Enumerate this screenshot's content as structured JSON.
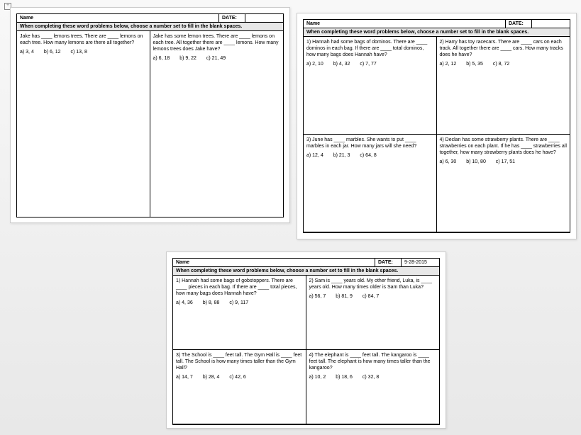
{
  "labels": {
    "name": "Name",
    "date": "DATE:",
    "instruction": "When completing these word problems below, choose a number set to fill in the blank spaces.",
    "handle": "+"
  },
  "pages": [
    {
      "date_value": "",
      "layout": "grid2",
      "cells": [
        {
          "text": "Jake has ____ lemons trees. There are ____ lemons on each tree. How many lemons are there all together?",
          "opts": [
            "a) 3, 4",
            "b) 6, 12",
            "c) 13, 8"
          ]
        },
        {
          "text": "Jake has some lemon trees. There are ____ lemons on each tree. All together there are ____ lemons. How many lemons trees does Jake have?",
          "opts": [
            "a) 6, 18",
            "b) 9, 22",
            "c) 21, 49"
          ]
        }
      ]
    },
    {
      "date_value": "",
      "layout": "grid4",
      "cells": [
        {
          "text": "1) Hannah had some bags of dominos. There are ____ dominos in each bag. If there are ____ total dominos, how many bags does Hannah have?",
          "opts": [
            "a) 2, 10",
            "b) 4, 32",
            "c) 7, 77"
          ]
        },
        {
          "text": "2) Harry has toy racecars. There are ____ cars on each track. All together there are ____ cars. How many tracks does he have?",
          "opts": [
            "a) 2, 12",
            "b) 5, 35",
            "c) 8, 72"
          ]
        },
        {
          "text": "3) June has ____ marbles. She wants to put ____ marbles in each jar. How many jars will she need?",
          "opts": [
            "a) 12, 4",
            "b) 21, 3",
            "c) 64, 8"
          ]
        },
        {
          "text": "4) Declan has some strawberry plants. There are ____ strawberries on each plant. If he has ____ strawberries all together, how many strawberry plants does he have?",
          "opts": [
            "a) 6, 30",
            "b) 10, 80",
            "c) 17, 51"
          ]
        }
      ]
    },
    {
      "date_value": "9-28-2015",
      "layout": "grid4b",
      "cells": [
        {
          "text": "1) Hannah had some bags of gobstoppers. There are ____ pieces in each bag. If there are ____ total pieces, how many bags does Hannah have?",
          "opts": [
            "a) 4, 36",
            "b) 8, 88",
            "c) 9, 117"
          ]
        },
        {
          "text": "2) Sam is ____ years old. My other friend, Luka, is ____ years old. How many times older is Sam than Luka?",
          "opts": [
            "a) 56, 7",
            "b) 81, 9",
            "c) 84, 7"
          ]
        },
        {
          "text": "3) The School is ____ feet tall. The Gym Hall is ____ feet tall. The School is how many times taller than the Gym Hall?",
          "opts": [
            "a) 14, 7",
            "b) 28, 4",
            "c)  42, 6"
          ]
        },
        {
          "text": "4) The elephant is ____ feet tall. The kangaroo is ____ feet tall. The elephant is how many times taller than the kangaroo?",
          "opts": [
            "a) 10, 2",
            "b) 18, 6",
            "c) 32, 8"
          ]
        }
      ]
    }
  ]
}
